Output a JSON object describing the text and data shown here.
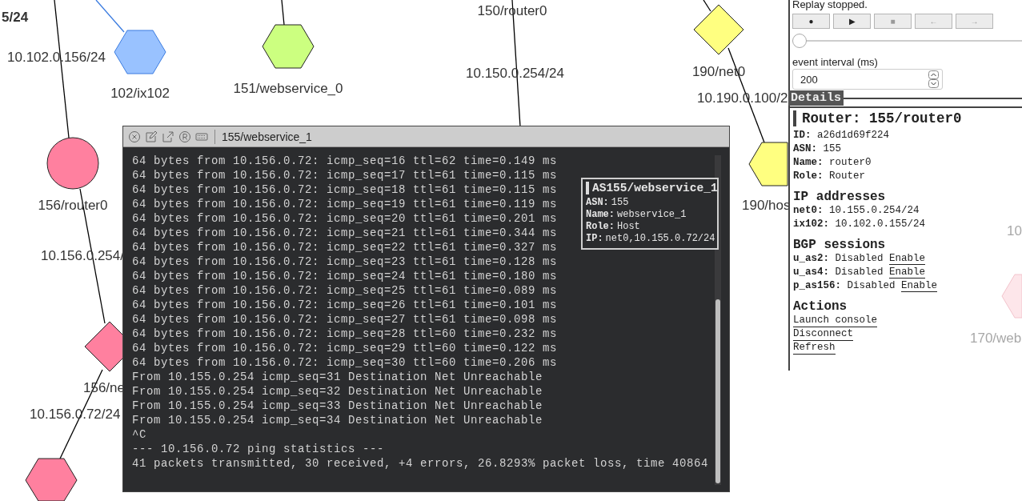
{
  "graph": {
    "nodes": [
      {
        "kind": "hexagon",
        "color": "#99c2ff",
        "label": "102/ix102"
      },
      {
        "kind": "hexagon",
        "color": "#ccff80",
        "label": "151/webservice_0"
      },
      {
        "kind": "circle",
        "color": "#ff809f",
        "label": "156/router0"
      },
      {
        "kind": "diamond",
        "color": "#ff809f",
        "label": "156/ne"
      },
      {
        "kind": "hexagon",
        "color": "#ff809f"
      },
      {
        "kind": "diamond",
        "color": "#ffff80",
        "label": "190/net0"
      },
      {
        "kind": "hexagon",
        "color": "#ffff80",
        "label": "190/hos"
      },
      {
        "kind": "hexagon",
        "color": "#fde6ea",
        "label": "170/web"
      }
    ],
    "labels": [
      {
        "text": "5/24",
        "bold": true
      },
      {
        "text": "150/router0",
        "bold": false
      }
    ],
    "addresses": [
      "10.102.0.156/24",
      "10.150.0.254/24",
      "10.190.0.100/2",
      "10.156.0.254/",
      "10.156.0.72/24",
      "10"
    ]
  },
  "terminal": {
    "title": "155/webservice_1",
    "lines": [
      "64 bytes from 10.156.0.72: icmp_seq=16 ttl=62 time=0.149 ms",
      "64 bytes from 10.156.0.72: icmp_seq=17 ttl=61 time=0.115 ms",
      "64 bytes from 10.156.0.72: icmp_seq=18 ttl=61 time=0.115 ms",
      "64 bytes from 10.156.0.72: icmp_seq=19 ttl=61 time=0.119 ms",
      "64 bytes from 10.156.0.72: icmp_seq=20 ttl=61 time=0.201 ms",
      "64 bytes from 10.156.0.72: icmp_seq=21 ttl=61 time=0.344 ms",
      "64 bytes from 10.156.0.72: icmp_seq=22 ttl=61 time=0.327 ms",
      "64 bytes from 10.156.0.72: icmp_seq=23 ttl=61 time=0.128 ms",
      "64 bytes from 10.156.0.72: icmp_seq=24 ttl=61 time=0.180 ms",
      "64 bytes from 10.156.0.72: icmp_seq=25 ttl=61 time=0.089 ms",
      "64 bytes from 10.156.0.72: icmp_seq=26 ttl=61 time=0.101 ms",
      "64 bytes from 10.156.0.72: icmp_seq=27 ttl=61 time=0.098 ms",
      "64 bytes from 10.156.0.72: icmp_seq=28 ttl=60 time=0.232 ms",
      "64 bytes from 10.156.0.72: icmp_seq=29 ttl=60 time=0.122 ms",
      "64 bytes from 10.156.0.72: icmp_seq=30 ttl=60 time=0.206 ms",
      "From 10.155.0.254 icmp_seq=31 Destination Net Unreachable",
      "From 10.155.0.254 icmp_seq=32 Destination Net Unreachable",
      "From 10.155.0.254 icmp_seq=33 Destination Net Unreachable",
      "From 10.155.0.254 icmp_seq=34 Destination Net Unreachable",
      "^C",
      "--- 10.156.0.72 ping statistics ---",
      "41 packets transmitted, 30 received, +4 errors, 26.8293% packet loss, time 40864"
    ],
    "tooltip": {
      "title": "AS155/webservice_1",
      "fields": [
        {
          "key": "ASN:",
          "value": "155"
        },
        {
          "key": "Name:",
          "value": "webservice_1"
        },
        {
          "key": "Role:",
          "value": "Host"
        },
        {
          "key": "IP:",
          "value": "net0,10.155.0.72/24"
        }
      ]
    }
  },
  "replay": {
    "status": "Replay stopped.",
    "buttons": [
      {
        "glyph": "●",
        "disabled": false
      },
      {
        "glyph": "▶",
        "disabled": false
      },
      {
        "glyph": "■",
        "disabled": true
      },
      {
        "glyph": "←",
        "disabled": true
      },
      {
        "glyph": "→",
        "disabled": true
      }
    ],
    "slider": {
      "level": 0
    },
    "interval_label": "event interval (ms)",
    "interval_value": "200"
  },
  "details": {
    "tab": "Details",
    "heading": "Router: 155/router0",
    "fields": [
      {
        "key": "ID:",
        "value": "a26d1d69f224"
      },
      {
        "key": "ASN:",
        "value": "155"
      },
      {
        "key": "Name:",
        "value": "router0"
      },
      {
        "key": "Role:",
        "value": "Router"
      }
    ],
    "sections": [
      {
        "title": "IP addresses",
        "rows": [
          {
            "key": "net0:",
            "value": "10.155.0.254/24"
          },
          {
            "key": "ix102:",
            "value": "10.102.0.155/24"
          }
        ]
      },
      {
        "title": "BGP sessions",
        "rows": [
          {
            "key": "u_as2:",
            "value": "Disabled",
            "action": "Enable"
          },
          {
            "key": "u_as4:",
            "value": "Disabled",
            "action": "Enable"
          },
          {
            "key": "p_as156:",
            "value": "Disabled",
            "action": "Enable"
          }
        ]
      }
    ],
    "actions_title": "Actions",
    "actions": [
      "Launch console",
      "Disconnect",
      "Refresh"
    ]
  }
}
